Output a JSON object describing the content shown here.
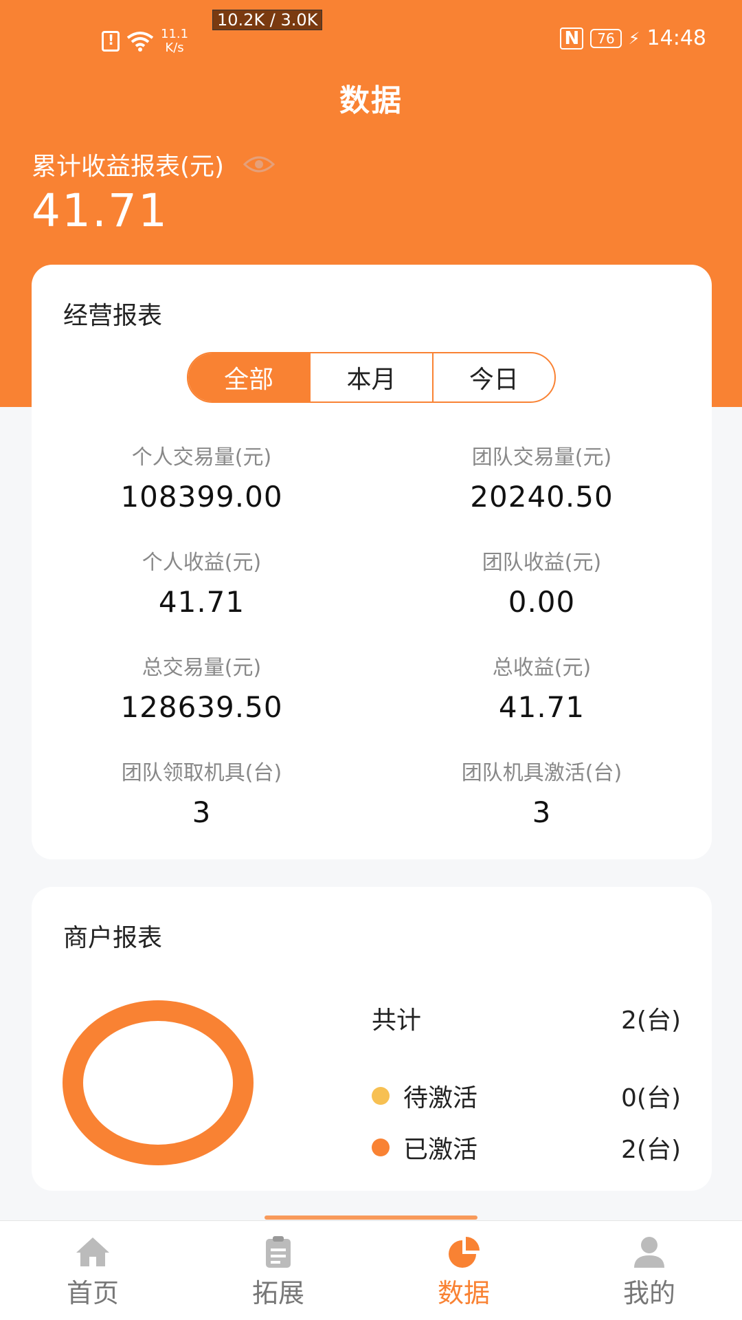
{
  "status_bar": {
    "speed_value": "11.1",
    "speed_unit": "K/s",
    "net_badge": "10.2K / 3.0K",
    "nfc": "N",
    "battery": "76",
    "time": "14:48"
  },
  "header": {
    "title": "数据",
    "cumulative_label": "累计收益报表(元)",
    "cumulative_value": "41.71"
  },
  "operations": {
    "title": "经营报表",
    "tabs": [
      {
        "label": "全部",
        "active": true
      },
      {
        "label": "本月",
        "active": false
      },
      {
        "label": "今日",
        "active": false
      }
    ],
    "stats": [
      {
        "label": "个人交易量(元)",
        "value": "108399.00"
      },
      {
        "label": "团队交易量(元)",
        "value": "20240.50"
      },
      {
        "label": "个人收益(元)",
        "value": "41.71"
      },
      {
        "label": "团队收益(元)",
        "value": "0.00"
      },
      {
        "label": "总交易量(元)",
        "value": "128639.50"
      },
      {
        "label": "总收益(元)",
        "value": "41.71"
      },
      {
        "label": "团队领取机具(台)",
        "value": "3"
      },
      {
        "label": "团队机具激活(台)",
        "value": "3"
      }
    ]
  },
  "merchant": {
    "title": "商户报表",
    "total_label": "共计",
    "total_value": "2(台)",
    "legend": [
      {
        "label": "待激活",
        "value": "0(台)",
        "color": "#f7c052"
      },
      {
        "label": "已激活",
        "value": "2(台)",
        "color": "#f98233"
      }
    ]
  },
  "tab_bar": {
    "items": [
      {
        "label": "首页",
        "icon": "home-icon",
        "active": false
      },
      {
        "label": "拓展",
        "icon": "clipboard-icon",
        "active": false
      },
      {
        "label": "数据",
        "icon": "pie-chart-icon",
        "active": true
      },
      {
        "label": "我的",
        "icon": "user-icon",
        "active": false
      }
    ]
  },
  "colors": {
    "accent": "#f98233",
    "pending": "#f7c052"
  }
}
